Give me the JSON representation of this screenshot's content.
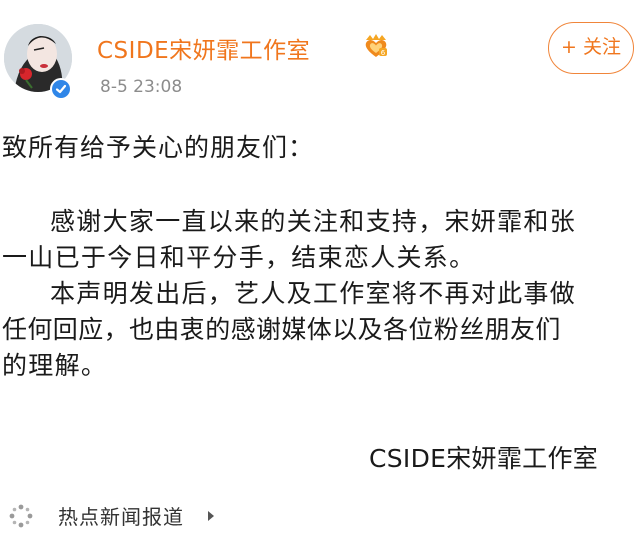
{
  "header": {
    "account_name": "CSIDE宋妍霏工作室",
    "post_time": "8-5 23:08",
    "follow_label": "+ 关注",
    "vip_icon": "crown-heart-icon",
    "verified_icon": "verified-check-icon"
  },
  "post": {
    "greeting": "致所有给予关心的朋友们：",
    "lines": [
      "感谢大家一直以来的关注和支持，宋妍霏和张",
      "一山已于今日和平分手，结束恋人关系。",
      "本声明发出后，艺人及工作室将不再对此事做",
      "任何回应，也由衷的感谢媒体以及各位粉丝朋友们",
      "的理解。"
    ],
    "signature": "CSIDE宋妍霏工作室"
  },
  "footer": {
    "hot_news_label": "热点新闻报道",
    "hot_news_icon": "sparkle-dots-icon",
    "arrow_icon": "triangle-right-icon"
  },
  "colors": {
    "accent": "#f0761d",
    "verified": "#2f86e8",
    "meta_text": "#8c8c8c"
  }
}
